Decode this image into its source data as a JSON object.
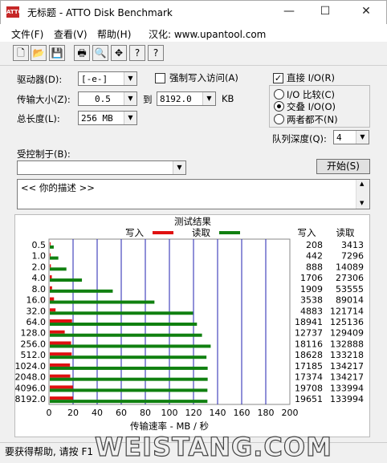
{
  "window": {
    "app_icon_text": "ATTO",
    "title": "无标题 - ATTO Disk Benchmark",
    "minimize": "—",
    "maximize": "☐",
    "close": "✕"
  },
  "menu": {
    "file": "文件(F)",
    "view": "查看(V)",
    "help": "帮助(H)",
    "localize": "汉化: www.upantool.com"
  },
  "toolbar": {
    "icons": [
      "new-icon",
      "open-icon",
      "save-icon",
      "print-icon",
      "print-preview-icon",
      "move-icon",
      "help-icon",
      "context-help-icon"
    ],
    "glyphs": [
      "🗋",
      "📂",
      "💾",
      "🖶",
      "🔍",
      "✥",
      "?",
      "?"
    ]
  },
  "form": {
    "drive_label": "驱动器(D):",
    "drive_value": "[-e-]",
    "force_write_label": "强制写入访问(A)",
    "transfer_size_label": "传输大小(Z):",
    "transfer_from": "0.5",
    "to_label": "到",
    "transfer_to": "8192.0",
    "kb_label": "KB",
    "total_length_label": "总长度(L):",
    "total_length_value": "256 MB",
    "direct_io_label": "直接 I/O(R)",
    "direct_io_checked": "✓",
    "io_compare_label": "I/O 比较(C)",
    "overlapped_io_label": "交叠 I/O(O)",
    "neither_label": "两者都不(N)",
    "queue_depth_label": "队列深度(Q):",
    "queue_depth_value": "4",
    "controlled_by_label": "受控制于(B):",
    "controlled_by_value": "",
    "start_button": "开始(S)",
    "description": "<<   你的描述    >>"
  },
  "status": {
    "help_text": "要获得帮助, 请按 F1",
    "watermark": "WEISTANG.COM"
  },
  "colors": {
    "write": "#e01010",
    "read": "#108010",
    "gridline": "#2020b0"
  },
  "chart_data": {
    "type": "bar",
    "title": "测试结果",
    "legend": [
      "写入",
      "读取"
    ],
    "legend_position": "top",
    "xlabel": "传输速率 - MB / 秒",
    "xlim": [
      0,
      200
    ],
    "xticks": [
      0,
      20,
      40,
      60,
      80,
      100,
      120,
      140,
      160,
      180,
      200
    ],
    "orientation": "horizontal",
    "write_header": "写入",
    "read_header": "读取",
    "categories": [
      "0.5",
      "1.0",
      "2.0",
      "4.0",
      "8.0",
      "16.0",
      "32.0",
      "64.0",
      "128.0",
      "256.0",
      "512.0",
      "1024.0",
      "2048.0",
      "4096.0",
      "8192.0"
    ],
    "series": [
      {
        "name": "写入",
        "values": [
          0.2,
          0.4,
          0.9,
          1.7,
          1.9,
          3.5,
          4.8,
          18.5,
          12.4,
          17.7,
          18.2,
          16.8,
          17.0,
          19.2,
          19.2
        ]
      },
      {
        "name": "读取",
        "values": [
          3.3,
          7.1,
          13.8,
          26.7,
          52.3,
          86.9,
          118.9,
          122.2,
          126.4,
          133.6,
          130.1,
          131.1,
          131.1,
          130.9,
          130.9
        ]
      }
    ],
    "write_values_kb": [
      "208",
      "442",
      "888",
      "1706",
      "1909",
      "3538",
      "4883",
      "18941",
      "12737",
      "18116",
      "18628",
      "17185",
      "17374",
      "19708",
      "19651"
    ],
    "read_values_kb": [
      "3413",
      "7296",
      "14089",
      "27306",
      "53555",
      "89014",
      "121714",
      "125136",
      "129409",
      "132888",
      "133218",
      "134217",
      "134217",
      "133994",
      "133994"
    ]
  }
}
